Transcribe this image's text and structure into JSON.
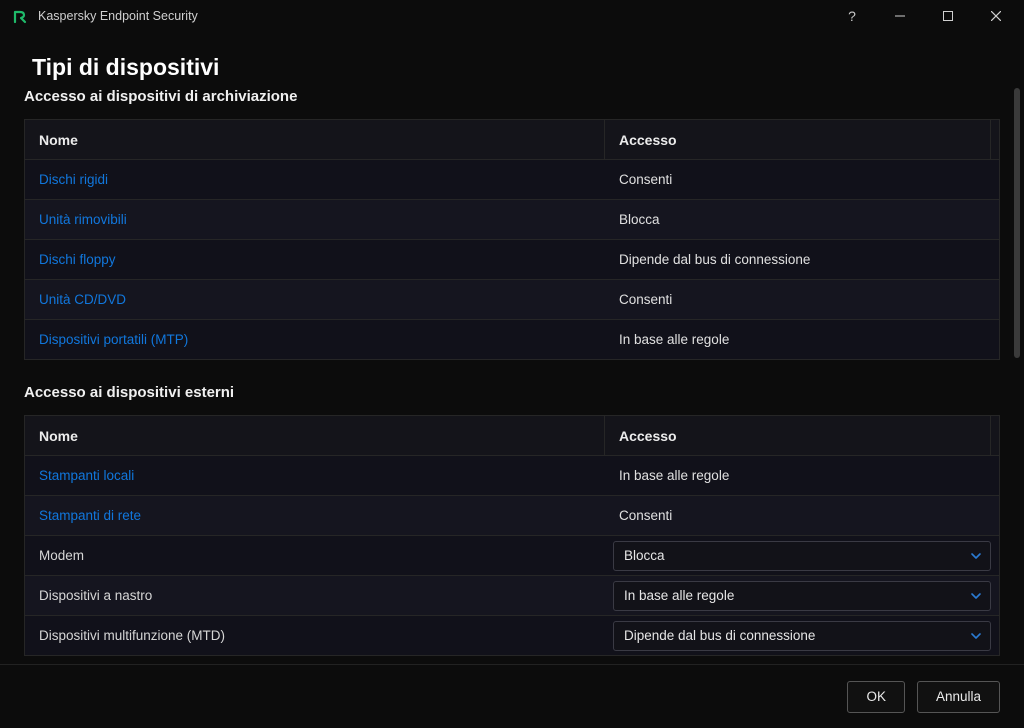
{
  "app": {
    "title": "Kaspersky Endpoint Security"
  },
  "page": {
    "title": "Tipi di dispositivi"
  },
  "sections": {
    "storage": {
      "title": "Accesso ai dispositivi di archiviazione",
      "columns": {
        "name": "Nome",
        "access": "Accesso"
      },
      "rows": [
        {
          "name": "Dischi rigidi",
          "access": "Consenti",
          "link": true
        },
        {
          "name": "Unità rimovibili",
          "access": "Blocca",
          "link": true
        },
        {
          "name": "Dischi floppy",
          "access": "Dipende dal bus di connessione",
          "link": true
        },
        {
          "name": "Unità CD/DVD",
          "access": "Consenti",
          "link": true
        },
        {
          "name": "Dispositivi portatili (MTP)",
          "access": "In base alle regole",
          "link": true
        }
      ]
    },
    "external": {
      "title": "Accesso ai dispositivi esterni",
      "columns": {
        "name": "Nome",
        "access": "Accesso"
      },
      "rows": [
        {
          "name": "Stampanti locali",
          "access": "In base alle regole",
          "link": true,
          "select": false
        },
        {
          "name": "Stampanti di rete",
          "access": "Consenti",
          "link": true,
          "select": false
        },
        {
          "name": "Modem",
          "access": "Blocca",
          "link": false,
          "select": true
        },
        {
          "name": "Dispositivi a nastro",
          "access": "In base alle regole",
          "link": false,
          "select": true
        },
        {
          "name": "Dispositivi multifunzione (MTD)",
          "access": "Dipende dal bus di connessione",
          "link": false,
          "select": true
        }
      ]
    }
  },
  "footer": {
    "ok": "OK",
    "cancel": "Annulla"
  }
}
